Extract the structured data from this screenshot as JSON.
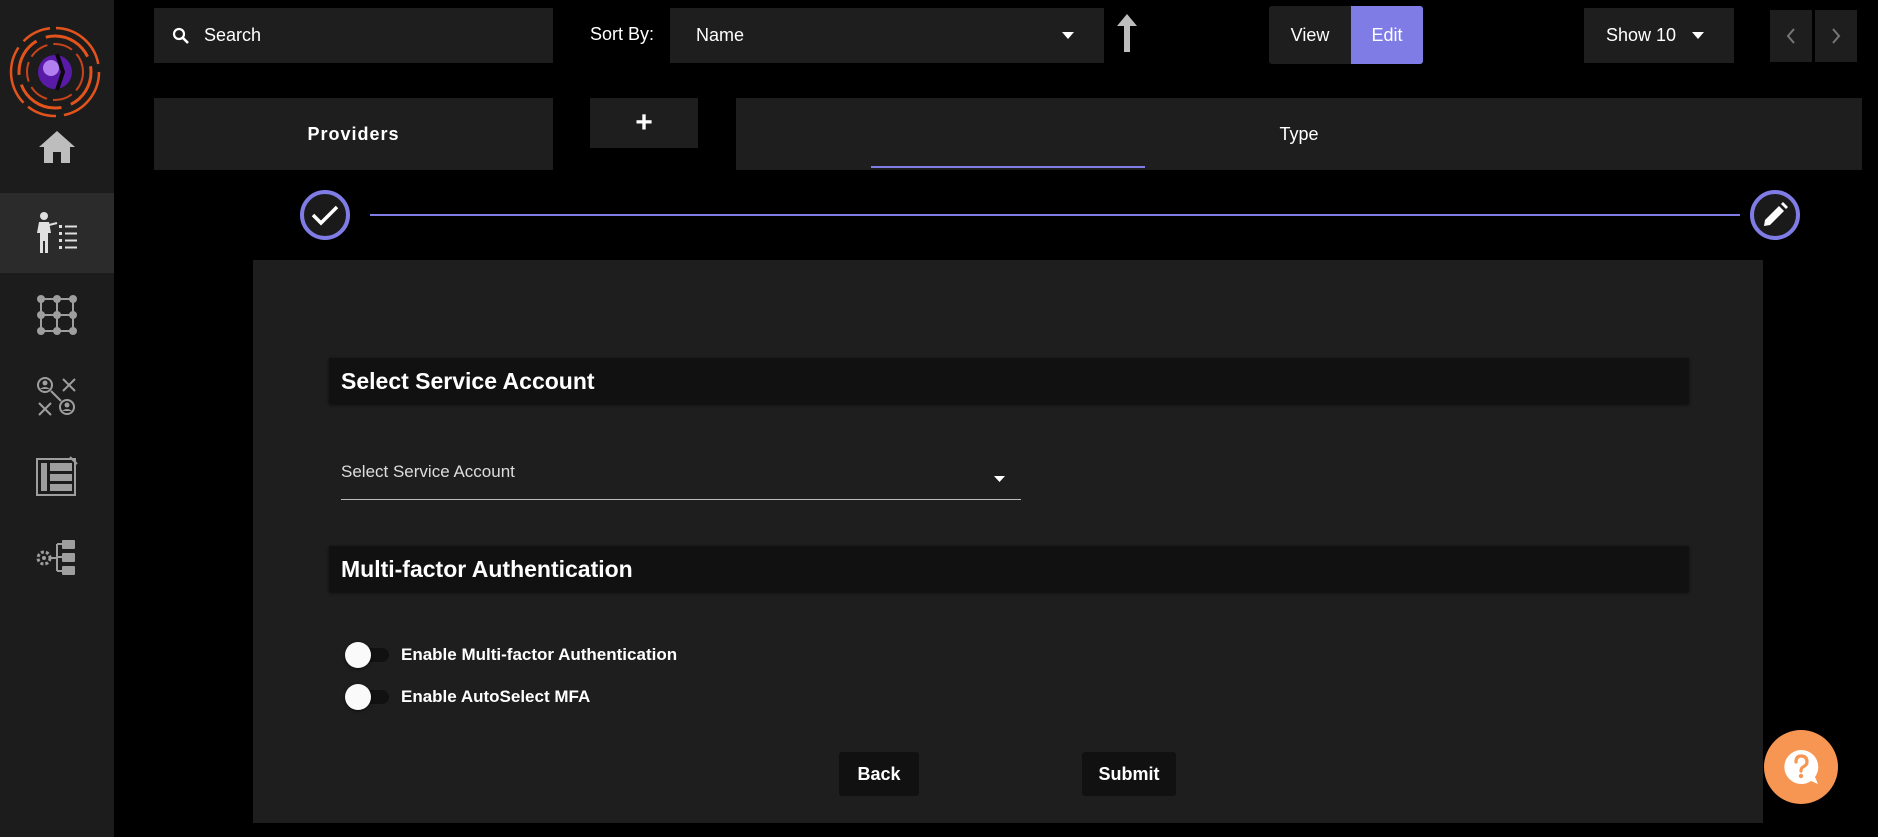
{
  "search": {
    "placeholder": "Search"
  },
  "sort": {
    "label": "Sort By:",
    "selected": "Name"
  },
  "view_toggle": {
    "view_label": "View",
    "edit_label": "Edit",
    "active": "Edit"
  },
  "show": {
    "selected": "Show 10"
  },
  "tabs": {
    "providers": "Providers",
    "add": "+",
    "type": "Type"
  },
  "sections": {
    "service_account": {
      "title": "Select Service Account",
      "select_placeholder": "Select Service Account"
    },
    "mfa": {
      "title": "Multi-factor Authentication",
      "toggles": [
        {
          "label": "Enable Multi-factor Authentication",
          "enabled": false
        },
        {
          "label": "Enable AutoSelect MFA",
          "enabled": false
        }
      ]
    }
  },
  "actions": {
    "back": "Back",
    "submit": "Submit"
  },
  "sidebar": {
    "items": [
      {
        "icon": "home-icon"
      },
      {
        "icon": "user-list-icon",
        "active": true
      },
      {
        "icon": "grid-nodes-icon"
      },
      {
        "icon": "user-network-icon"
      },
      {
        "icon": "layout-panel-icon"
      },
      {
        "icon": "settings-tree-icon"
      }
    ]
  },
  "colors": {
    "accent": "#7f7ce6",
    "help": "#f79552",
    "sidebar": "#1c1c1c",
    "surface": "#1e1e1e"
  }
}
